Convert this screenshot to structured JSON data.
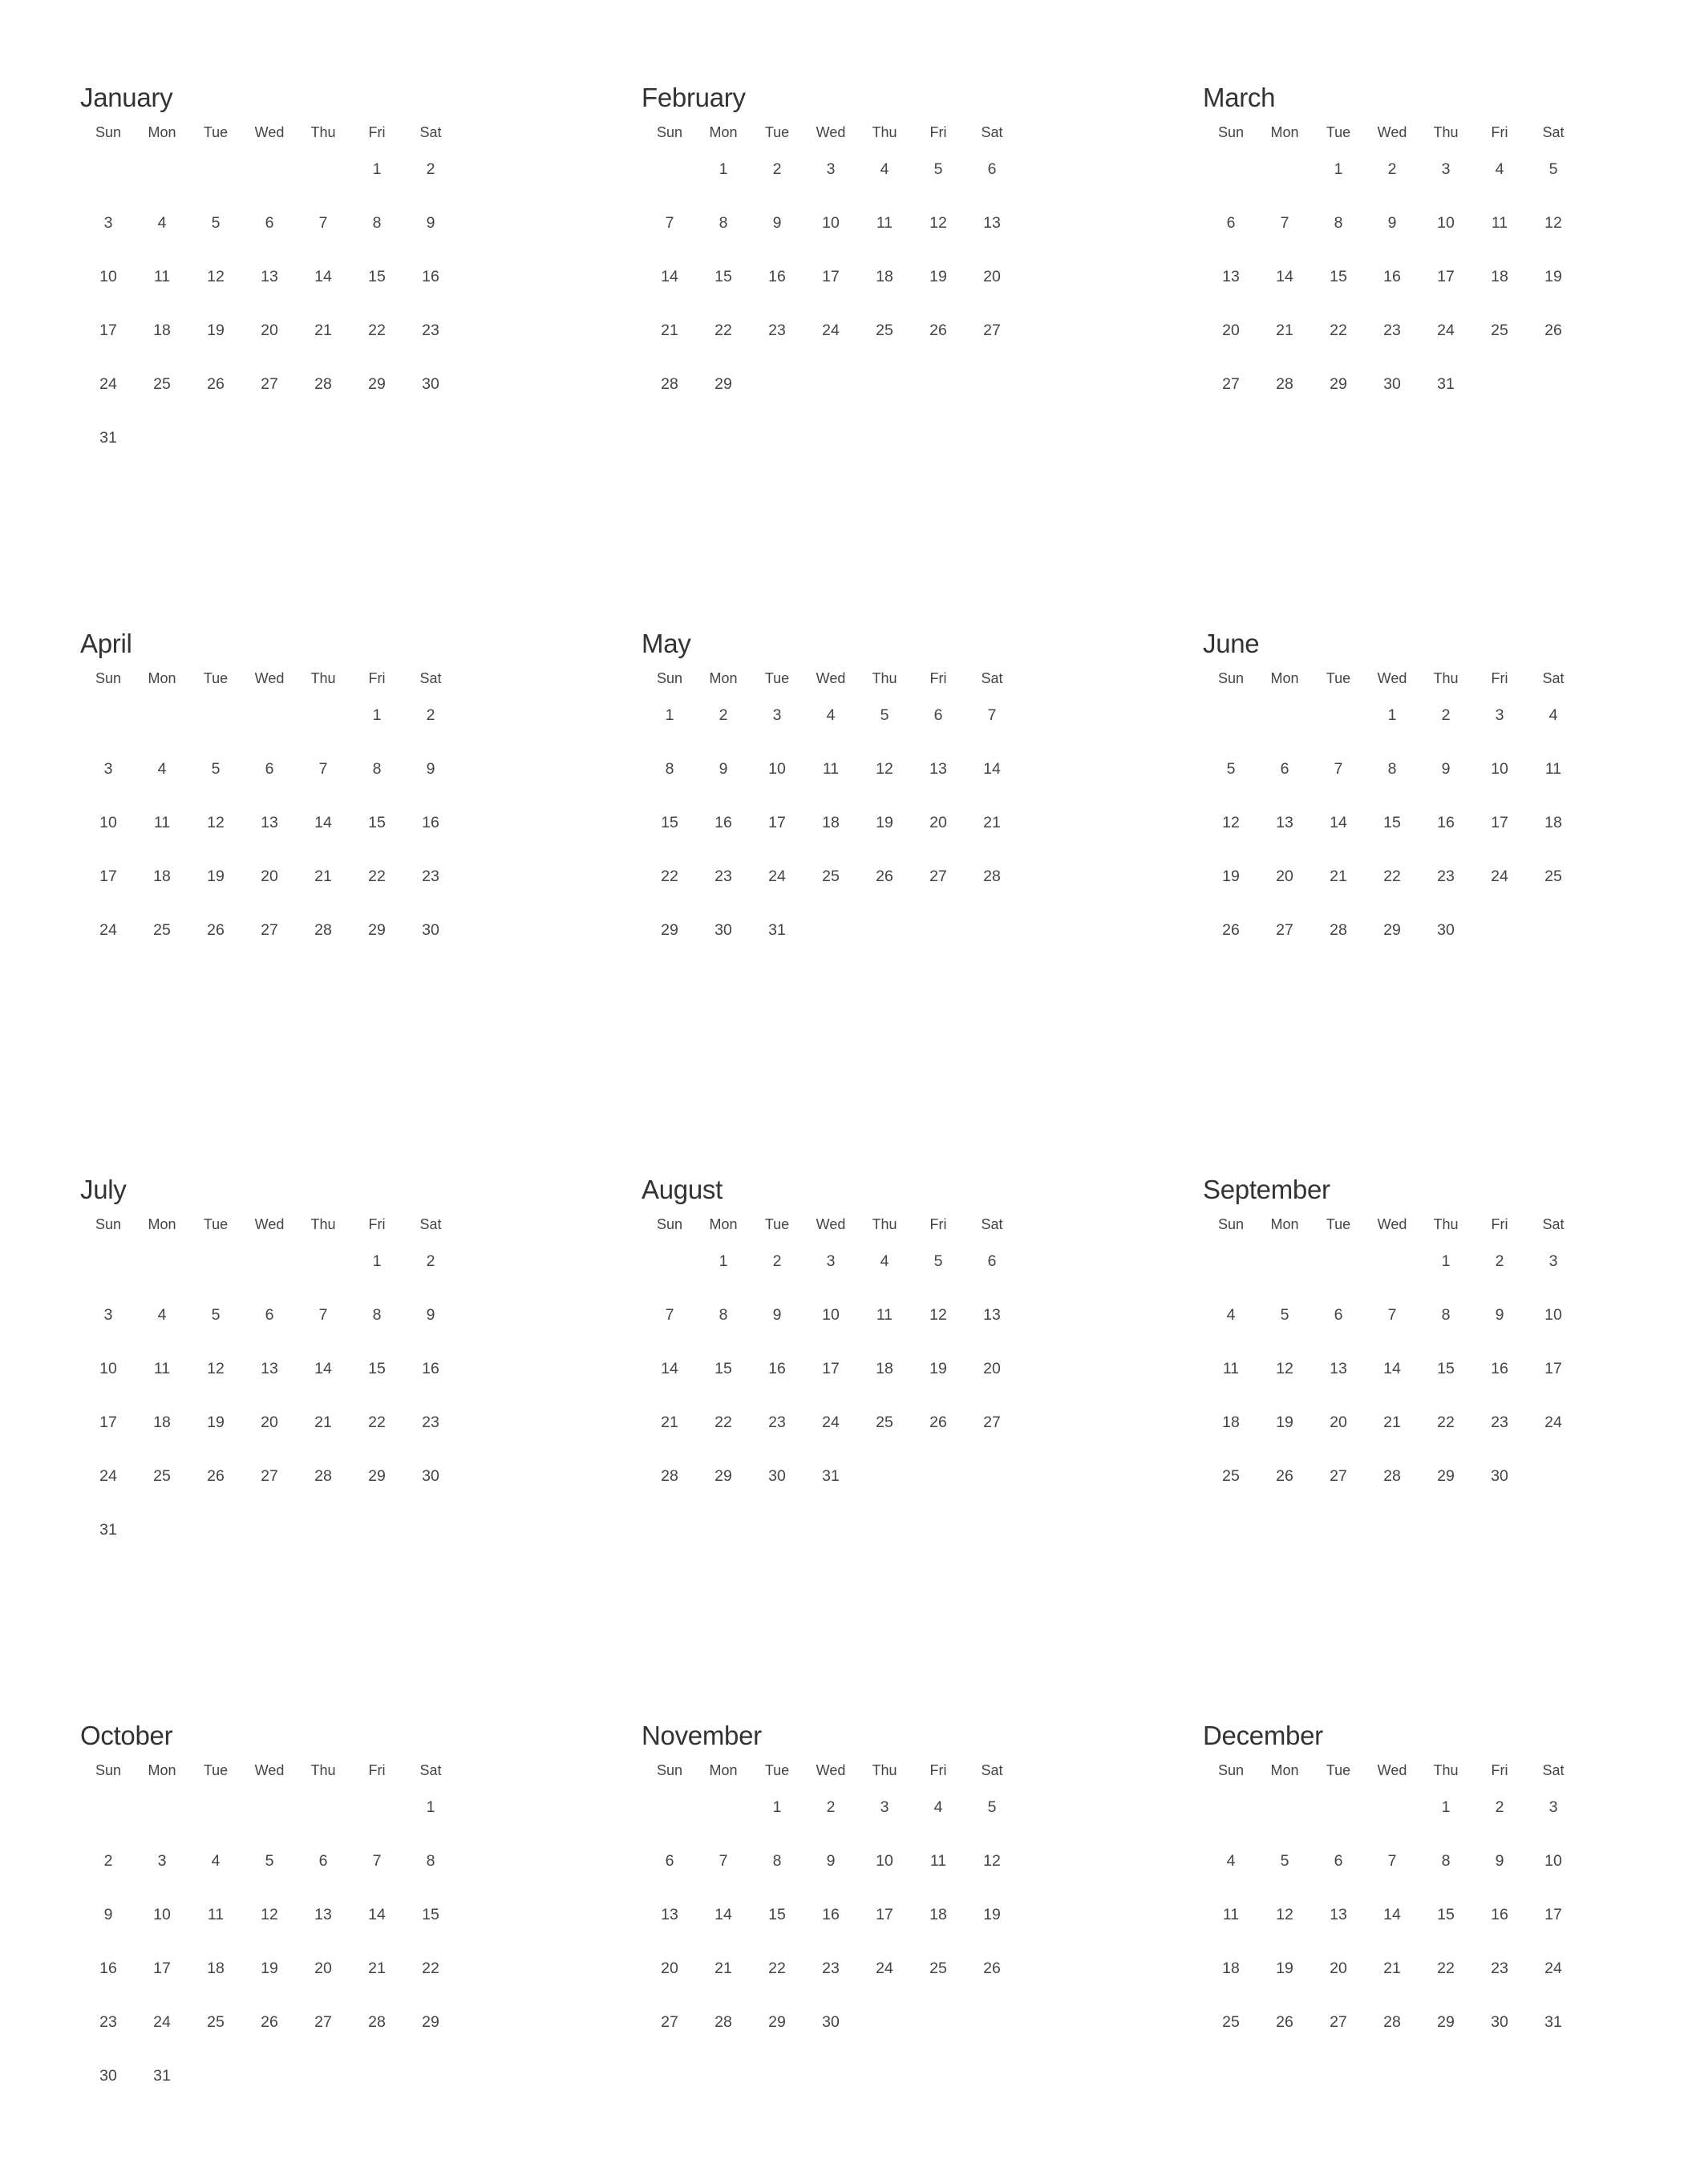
{
  "weekdays": [
    "Sun",
    "Mon",
    "Tue",
    "Wed",
    "Thu",
    "Fri",
    "Sat"
  ],
  "months": [
    {
      "name": "January",
      "first_weekday": 5,
      "days": 31
    },
    {
      "name": "February",
      "first_weekday": 1,
      "days": 29
    },
    {
      "name": "March",
      "first_weekday": 2,
      "days": 31
    },
    {
      "name": "April",
      "first_weekday": 5,
      "days": 30
    },
    {
      "name": "May",
      "first_weekday": 0,
      "days": 31
    },
    {
      "name": "June",
      "first_weekday": 3,
      "days": 30
    },
    {
      "name": "July",
      "first_weekday": 5,
      "days": 31
    },
    {
      "name": "August",
      "first_weekday": 1,
      "days": 31
    },
    {
      "name": "September",
      "first_weekday": 4,
      "days": 30
    },
    {
      "name": "October",
      "first_weekday": 6,
      "days": 31
    },
    {
      "name": "November",
      "first_weekday": 2,
      "days": 30
    },
    {
      "name": "December",
      "first_weekday": 4,
      "days": 31
    }
  ]
}
